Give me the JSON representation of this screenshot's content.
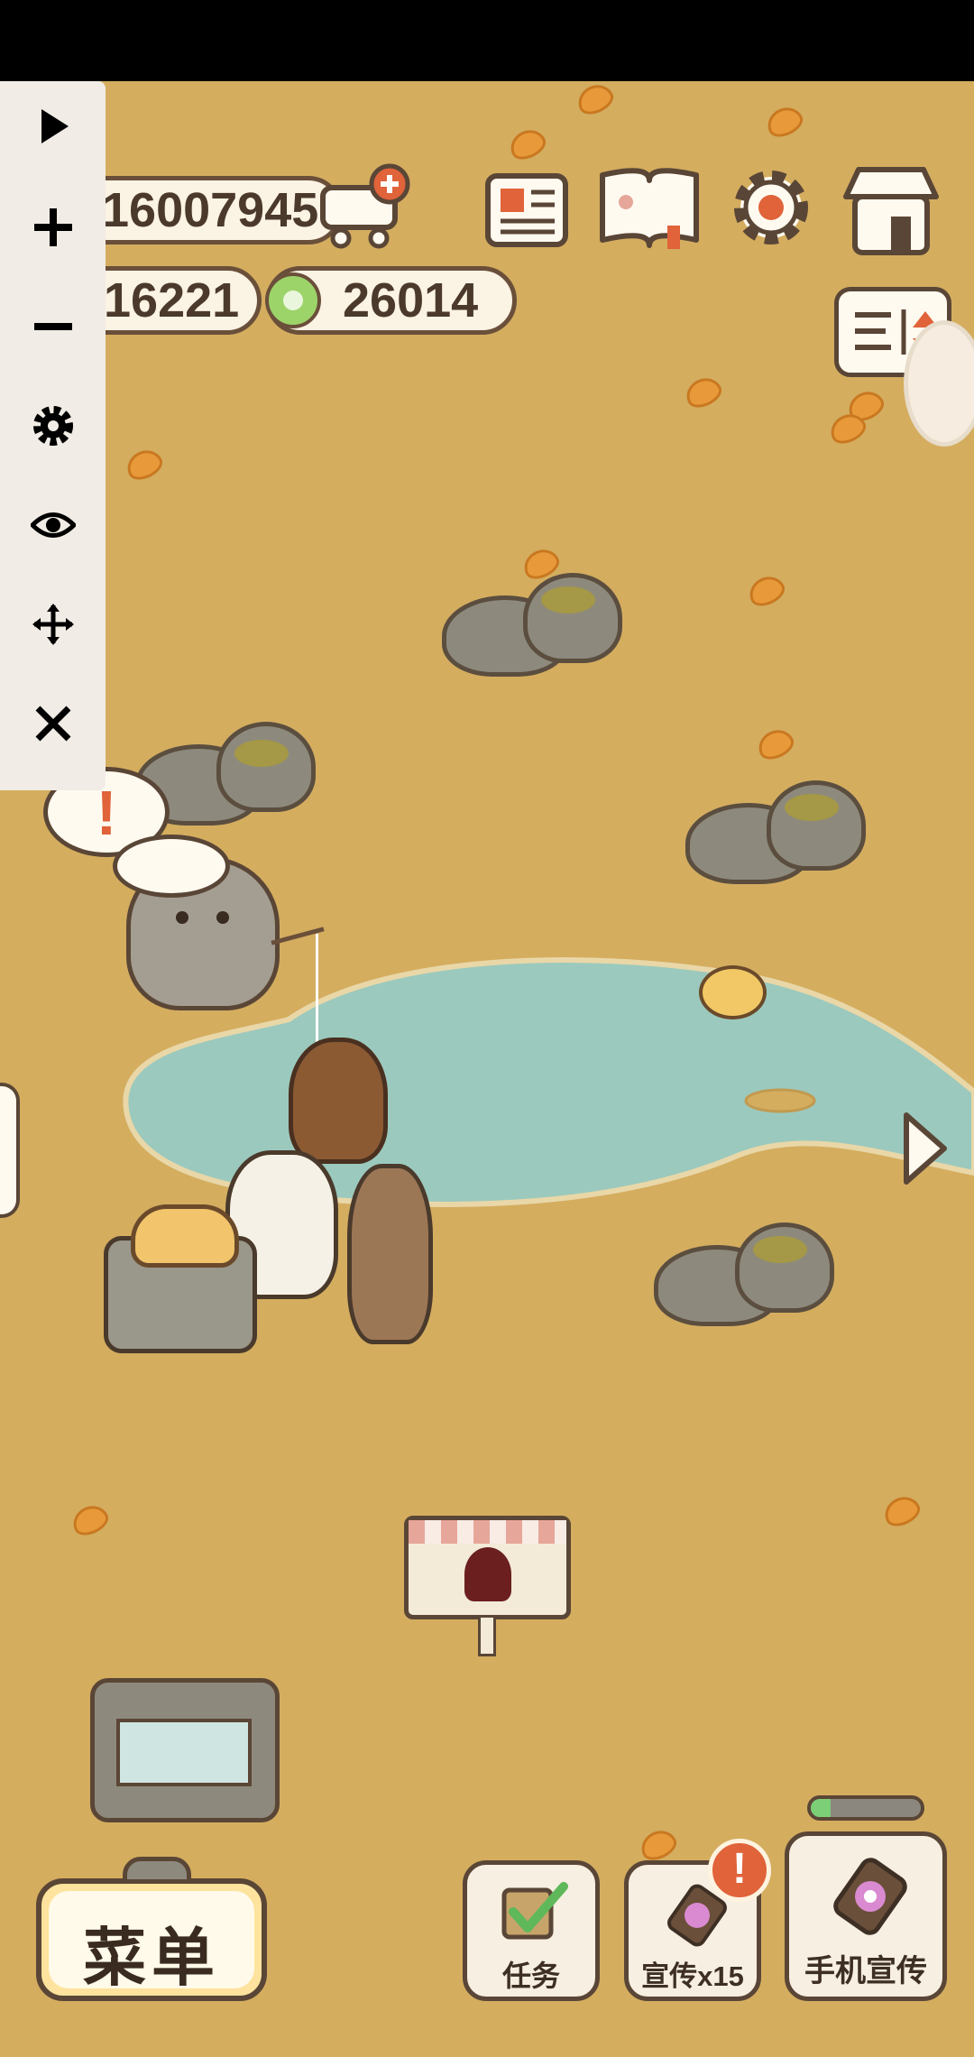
{
  "currency": {
    "fish": "16007945",
    "stars": "16221",
    "gems": "26014"
  },
  "progress": {
    "value": 0.18,
    "fill_color": "#7ccf76"
  },
  "bottom": {
    "menu_label": "菜单",
    "tasks_label": "任务",
    "promote_label": "宣传x15",
    "phone_promote_label": "手机宣传"
  },
  "alerts": {
    "exclaim": "!"
  },
  "icons": {
    "play": "play-icon",
    "zoom_in": "plus-icon",
    "zoom_out": "minus-icon",
    "settings": "gear-icon",
    "view": "eye-icon",
    "move": "move-icon",
    "close": "close-icon"
  },
  "colors": {
    "ground": "#d4ad5f",
    "pond": "#9cc9bd",
    "outline": "#5a4636",
    "accent": "#e0633a"
  }
}
